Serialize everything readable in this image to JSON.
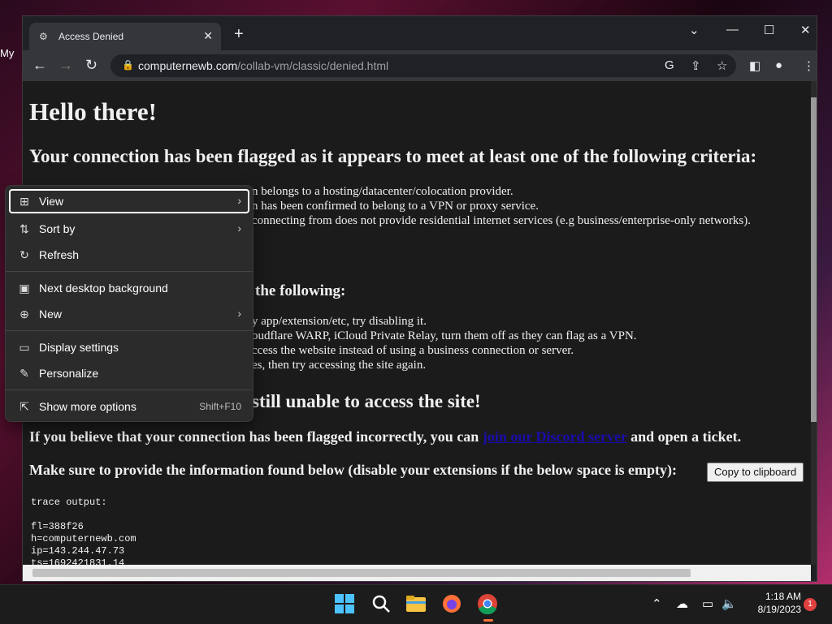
{
  "desktop": {
    "label": "My"
  },
  "browser": {
    "tab_title": "Access Denied",
    "url_domain": "computernewb.com",
    "url_path": "/collab-vm/classic/denied.html"
  },
  "page": {
    "heading": "Hello there!",
    "subheading": "Your connection has been flagged as it appears to meet at least one of the following criteria:",
    "criteria_lines": [
      "n belongs to a hosting/datacenter/colocation provider.",
      "n has been confirmed to belong to a VPN or proxy service.",
      "connecting from does not provide residential internet services (e.g business/enterprise-only networks)."
    ],
    "try_heading": "the following:",
    "try_lines": [
      "y app/extension/etc, try disabling it.",
      "oudflare WARP, iCloud Private Relay, turn them off as they can flag as a VPN.",
      "ccess the website instead of using a business connection or server.",
      "es, then try accessing the site again."
    ],
    "still_heading": "still unable to access the site!",
    "ticket_text_before": "If you believe that your connection has been flagged incorrectly, you can ",
    "ticket_link": "join our Discord server",
    "ticket_text_after": " and open a ticket.",
    "provide_text": "Make sure to provide the information found below (disable your extensions if the below space is empty):",
    "copy_button": "Copy to clipboard",
    "trace_label": "trace output:",
    "trace_lines": [
      "fl=388f26",
      "h=computernewb.com",
      "ip=143.244.47.73",
      "ts=1692421831.14"
    ]
  },
  "context_menu": {
    "items": [
      {
        "label": "View",
        "icon": "grid-icon"
      },
      {
        "label": "Sort by",
        "icon": "sort-icon"
      },
      {
        "label": "Refresh",
        "icon": "refresh-icon"
      },
      {
        "label": "Next desktop background",
        "icon": "image-icon"
      },
      {
        "label": "New",
        "icon": "plus-circle-icon"
      },
      {
        "label": "Display settings",
        "icon": "monitor-icon"
      },
      {
        "label": "Personalize",
        "icon": "brush-icon"
      },
      {
        "label": "Show more options",
        "icon": "share-icon",
        "shortcut": "Shift+F10"
      }
    ]
  },
  "taskbar": {
    "time": "1:18 AM",
    "date": "8/19/2023",
    "notification_count": "1"
  },
  "colors": {
    "accent": "#0078d4",
    "link": "#1a0dab",
    "page_bg": "#1b1b1b"
  }
}
